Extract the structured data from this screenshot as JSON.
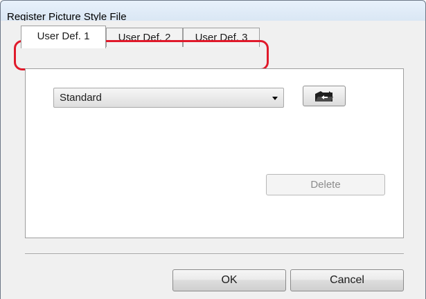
{
  "window": {
    "title": "Register Picture Style File"
  },
  "tabs": [
    {
      "label": "User Def. 1",
      "selected": true
    },
    {
      "label": "User Def. 2",
      "selected": false
    },
    {
      "label": "User Def. 3",
      "selected": false
    }
  ],
  "panel": {
    "style_select": {
      "value": "Standard"
    },
    "load_button": {
      "icon": "open-folder-icon"
    },
    "delete_button": {
      "label": "Delete",
      "enabled": false
    }
  },
  "footer": {
    "ok_label": "OK",
    "cancel_label": "Cancel"
  },
  "colors": {
    "highlight": "#e01a2b",
    "title_bar": "#d9e6f4"
  }
}
